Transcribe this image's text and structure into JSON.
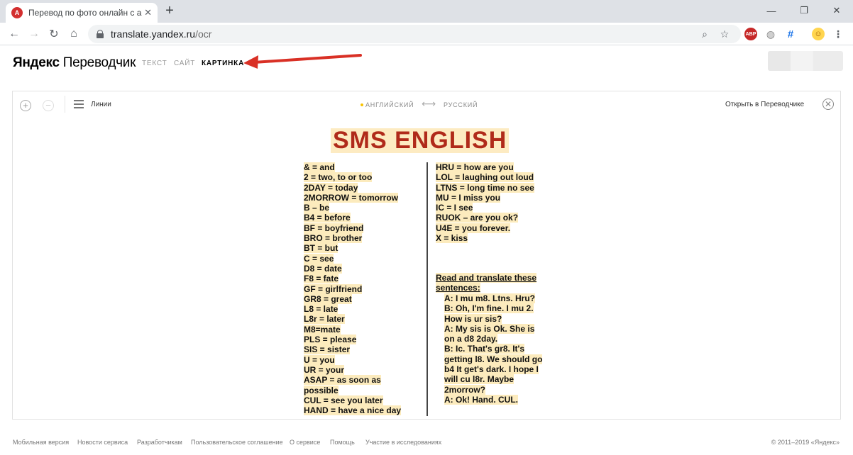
{
  "browser": {
    "tab_title": "Перевод по фото онлайн с англ",
    "tab_favicon_text": "ABP",
    "url_host": "translate.yandex.ru",
    "url_path": "/ocr",
    "extension_abp": "ABP"
  },
  "header": {
    "brand_first": "Яндекс",
    "brand_second": "Переводчик",
    "tabs": [
      "ТЕКСТ",
      "САЙТ",
      "КАРТИНКА"
    ],
    "active_tab": "КАРТИНКА"
  },
  "ocr": {
    "lines_label": "Линии",
    "source_lang": "АНГЛИЙСКИЙ",
    "target_lang": "РУССКИЙ",
    "open_in_translator": "Открыть в Переводчике",
    "image_title": "SMS ENGLISH",
    "left_terms": [
      "& = and",
      "2 = two, to or too",
      "2DAY = today",
      "2MORROW = tomorrow",
      "B – be",
      "B4 = before",
      "BF = boyfriend",
      "BRO = brother",
      "BT = but",
      "C = see",
      "D8 = date",
      "F8 = fate",
      "GF = girlfriend",
      "GR8 = great",
      "L8 = late",
      "L8r = later",
      "M8=mate",
      "PLS = please",
      "SIS = sister",
      "U = you",
      "UR = your",
      "ASAP = as soon as",
      "possible",
      "CUL = see you later",
      "HAND = have a nice day"
    ],
    "right_terms": [
      "HRU = how are you",
      "LOL = laughing out loud",
      "LTNS = long time no see",
      "MU = I miss you",
      "IC = I see",
      "RUOK – are you ok?",
      "U4E = you forever.",
      "X = kiss"
    ],
    "exercise_heading_1": "Read and translate these",
    "exercise_heading_2": "sentences:",
    "exercise_lines": [
      "A: I mu m8. Ltns. Hru?",
      "B: Oh, I'm fine. I mu 2.",
      "How is ur sis?",
      "A: My sis is Ok. She is",
      "on  a d8 2day.",
      "B: Ic. That's gr8. It's",
      "getting l8. We should go",
      "b4 It get's dark. I hope I",
      "will cu l8r. Maybe",
      "2morrow?",
      "A: Ok! Hand. CUL."
    ]
  },
  "footer": {
    "links": [
      "Мобильная версия",
      "Новости сервиса",
      "Разработчикам",
      "Пользовательское соглашение",
      "О сервисе",
      "Помощь",
      "Участие в исследованиях"
    ],
    "copyright": "© 2011–2019 «Яндекс»"
  }
}
